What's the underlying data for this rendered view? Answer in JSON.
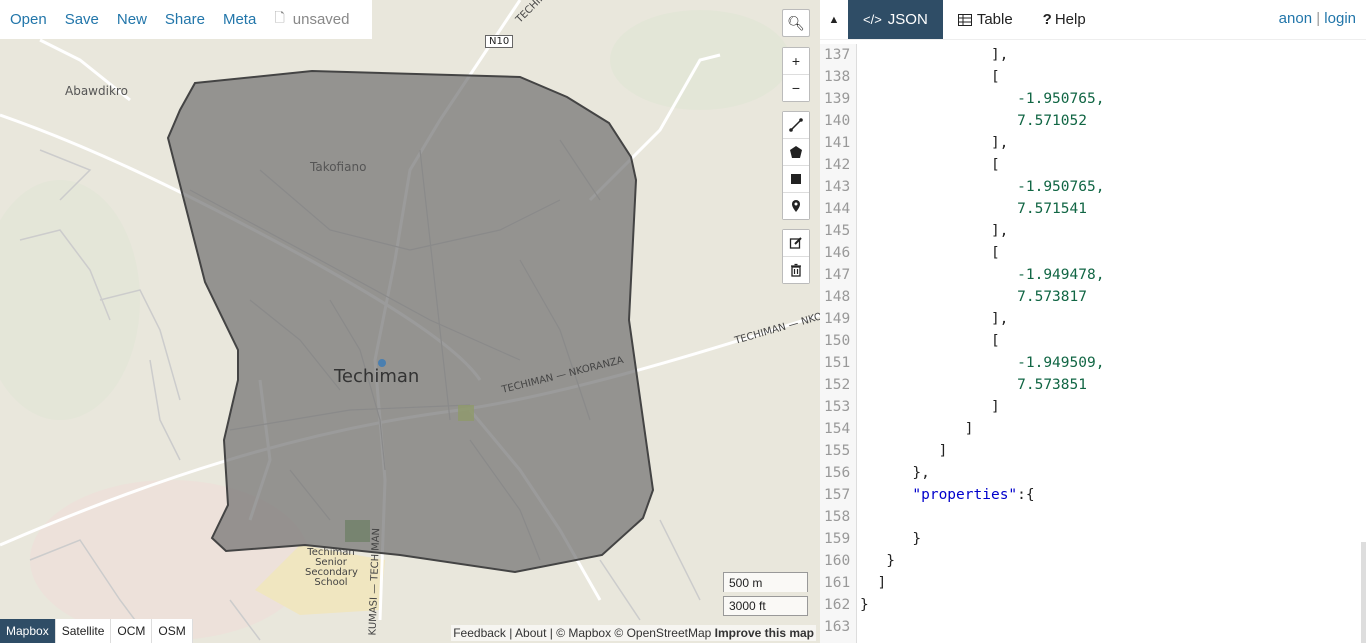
{
  "toolbar": {
    "open": "Open",
    "save": "Save",
    "new": "New",
    "share": "Share",
    "meta": "Meta",
    "unsaved": "unsaved"
  },
  "map": {
    "labels": {
      "city": "Techiman",
      "takofiano": "Takofiano",
      "abawdikro": "Abawdikro",
      "school_line1": "Techiman",
      "school_line2": "Senior",
      "school_line3": "Secondary",
      "school_line4": "School"
    },
    "roads": {
      "n10": "N10",
      "techiman_top": "TECHIMAN",
      "techiman_nkoranza": "TECHIMAN — NKORANZA",
      "techiman_nkoranza_right": "TECHIMAN — NKO",
      "kumasi": "KUMASI — TECHIMAN"
    },
    "scale": {
      "metric": "500 m",
      "imperial": "3000 ft"
    },
    "layers": [
      "Mapbox",
      "Satellite",
      "OCM",
      "OSM"
    ],
    "active_layer": "Mapbox",
    "attribution": {
      "feedback": "Feedback",
      "about": "About",
      "copyright": "| © Mapbox © OpenStreetMap",
      "improve": "Improve this map"
    },
    "polygon_fill": "#6b6b6b"
  },
  "panel": {
    "tabs": {
      "json": "JSON",
      "table": "Table",
      "help": "Help"
    },
    "auth": {
      "anon": "anon",
      "sep": "|",
      "login": "login"
    },
    "code_lines": [
      {
        "n": "137",
        "t": "               ],"
      },
      {
        "n": "138",
        "t": "               ["
      },
      {
        "n": "139",
        "t": "                  -1.950765,"
      },
      {
        "n": "140",
        "t": "                  7.571052"
      },
      {
        "n": "141",
        "t": "               ],"
      },
      {
        "n": "142",
        "t": "               ["
      },
      {
        "n": "143",
        "t": "                  -1.950765,"
      },
      {
        "n": "144",
        "t": "                  7.571541"
      },
      {
        "n": "145",
        "t": "               ],"
      },
      {
        "n": "146",
        "t": "               ["
      },
      {
        "n": "147",
        "t": "                  -1.949478,"
      },
      {
        "n": "148",
        "t": "                  7.573817"
      },
      {
        "n": "149",
        "t": "               ],"
      },
      {
        "n": "150",
        "t": "               ["
      },
      {
        "n": "151",
        "t": "                  -1.949509,"
      },
      {
        "n": "152",
        "t": "                  7.573851"
      },
      {
        "n": "153",
        "t": "               ]"
      },
      {
        "n": "154",
        "t": "            ]"
      },
      {
        "n": "155",
        "t": "         ]"
      },
      {
        "n": "156",
        "t": "      },"
      },
      {
        "n": "157",
        "t": "      \"properties\":{"
      },
      {
        "n": "158",
        "t": ""
      },
      {
        "n": "159",
        "t": "      }"
      },
      {
        "n": "160",
        "t": "   }"
      },
      {
        "n": "161",
        "t": "  ]"
      },
      {
        "n": "162",
        "t": "}"
      },
      {
        "n": "163",
        "t": ""
      }
    ]
  }
}
